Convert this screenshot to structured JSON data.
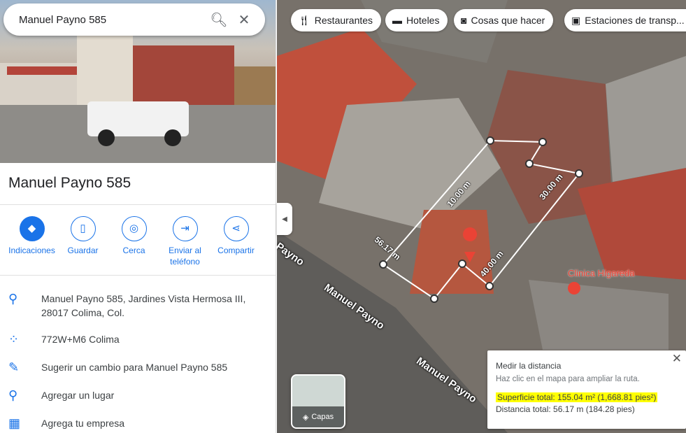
{
  "search": {
    "query": "Manuel Payno 585"
  },
  "place": {
    "title": "Manuel Payno 585"
  },
  "actions": [
    {
      "label": "Indicaciones"
    },
    {
      "label": "Guardar"
    },
    {
      "label": "Cerca"
    },
    {
      "label": "Enviar al teléfono"
    },
    {
      "label": "Compartir"
    }
  ],
  "info": [
    {
      "icon": "location-pin-icon",
      "text": "Manuel Payno 585, Jardines Vista Hermosa III, 28017 Colima, Col."
    },
    {
      "icon": "plus-code-icon",
      "text": "772W+M6 Colima"
    },
    {
      "icon": "pencil-icon",
      "text": "Sugerir un cambio para Manuel Payno 585"
    },
    {
      "icon": "add-place-icon",
      "text": "Agregar un lugar"
    },
    {
      "icon": "add-business-icon",
      "text": "Agrega tu empresa"
    }
  ],
  "chips": [
    {
      "label": "Restaurantes"
    },
    {
      "label": "Hoteles"
    },
    {
      "label": "Cosas que hacer"
    },
    {
      "label": "Estaciones de transp..."
    }
  ],
  "map": {
    "streets": [
      "Manuel Payno",
      "Manuel Payno",
      "Payno"
    ],
    "poi": "Clinica Higareda",
    "segments": [
      "10.00 m",
      "30.00 m",
      "56.17 m",
      "40.00 m"
    ],
    "layers_label": "Capas"
  },
  "measure": {
    "title": "Medir la distancia",
    "hint": "Haz clic en el mapa para ampliar la ruta.",
    "area": "Superficie total: 155.04 m² (1,668.81 pies²)",
    "distance": "Distancia total: 56.17 m (184.28 pies)"
  },
  "colors": {
    "accent": "#1a73e8",
    "highlight": "#ffff00"
  }
}
